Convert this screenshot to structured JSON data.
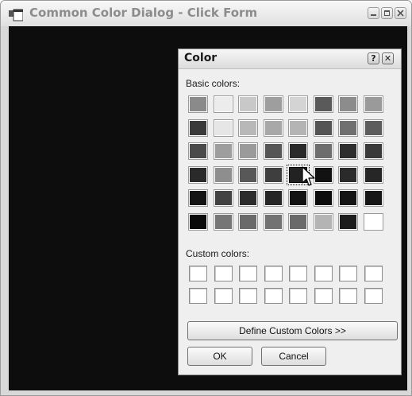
{
  "window": {
    "title": "Common Color Dialog - Click Form",
    "icon": "app-window-icon"
  },
  "dialog": {
    "title": "Color",
    "help_label": "?",
    "close_label": "✕",
    "basic_colors_label": "Basic colors:",
    "custom_colors_label": "Custom colors:",
    "define_button": "Define Custom Colors >>",
    "ok_button": "OK",
    "cancel_button": "Cancel",
    "basic_colors": [
      [
        "#8a8a8a",
        "#ececec",
        "#c8c8c8",
        "#9e9e9e",
        "#d4d4d4",
        "#5a5a5a",
        "#8c8c8c",
        "#9a9a9a"
      ],
      [
        "#3a3a3a",
        "#e6e6e6",
        "#b8b8b8",
        "#a8a8a8",
        "#b4b4b4",
        "#545454",
        "#707070",
        "#5c5c5c"
      ],
      [
        "#4a4a4a",
        "#9e9e9e",
        "#9a9a9a",
        "#565656",
        "#2a2a2a",
        "#6e6e6e",
        "#2e2e2e",
        "#3a3a3a"
      ],
      [
        "#2a2a2a",
        "#8e8e8e",
        "#585858",
        "#3e3e3e",
        "#222222",
        "#121212",
        "#2a2a2a",
        "#262626"
      ],
      [
        "#141414",
        "#424242",
        "#2c2c2c",
        "#262626",
        "#121212",
        "#0c0c0c",
        "#141414",
        "#161616"
      ],
      [
        "#0a0a0a",
        "#767676",
        "#6a6a6a",
        "#727272",
        "#6a6a6a",
        "#b4b4b4",
        "#1c1c1c",
        "#ffffff"
      ]
    ],
    "selected_swatch": [
      3,
      4
    ],
    "custom_colors": [
      [
        "#ffffff",
        "#ffffff",
        "#ffffff",
        "#ffffff",
        "#ffffff",
        "#ffffff",
        "#ffffff",
        "#ffffff"
      ],
      [
        "#ffffff",
        "#ffffff",
        "#ffffff",
        "#ffffff",
        "#ffffff",
        "#ffffff",
        "#ffffff",
        "#ffffff"
      ]
    ]
  }
}
